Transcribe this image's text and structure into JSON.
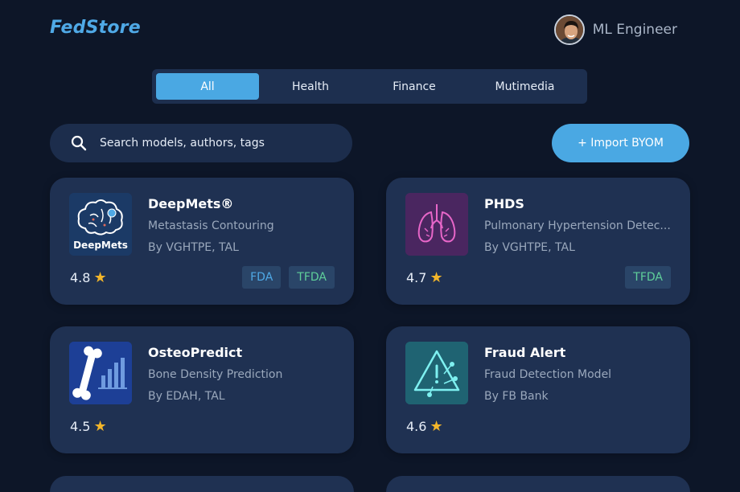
{
  "header": {
    "logo": "FedStore",
    "user_name": "ML Engineer"
  },
  "tabs": [
    {
      "label": "All",
      "active": true
    },
    {
      "label": "Health",
      "active": false
    },
    {
      "label": "Finance",
      "active": false
    },
    {
      "label": "Mutimedia",
      "active": false
    }
  ],
  "search": {
    "placeholder": "Search models, authors, tags"
  },
  "import_button": {
    "label": "+ Import BYOM"
  },
  "cards": [
    {
      "title": "DeepMets®",
      "subtitle": "Metastasis Contouring",
      "author": "By VGHTPE, TAL",
      "rating": "4.8",
      "badges": [
        "FDA",
        "TFDA"
      ],
      "thumb_text": "DeepMets"
    },
    {
      "title": "PHDS",
      "subtitle": "Pulmonary Hypertension Detec...",
      "author": "By VGHTPE, TAL",
      "rating": "4.7",
      "badges": [
        "TFDA"
      ]
    },
    {
      "title": "OsteoPredict",
      "subtitle": "Bone Density Prediction",
      "author": "By EDAH, TAL",
      "rating": "4.5",
      "badges": []
    },
    {
      "title": "Fraud Alert",
      "subtitle": "Fraud Detection Model",
      "author": "By FB Bank",
      "rating": "4.6",
      "badges": []
    }
  ],
  "colors": {
    "background": "#0d1628",
    "card": "#1f3152",
    "accent": "#4aa8e3",
    "star": "#f2b52a",
    "fda_badge_text": "#4fa9e6",
    "tfda_badge_text": "#5fcf9a"
  },
  "icons": {
    "search": "search-icon",
    "star": "star-icon",
    "avatar": "user-avatar"
  }
}
